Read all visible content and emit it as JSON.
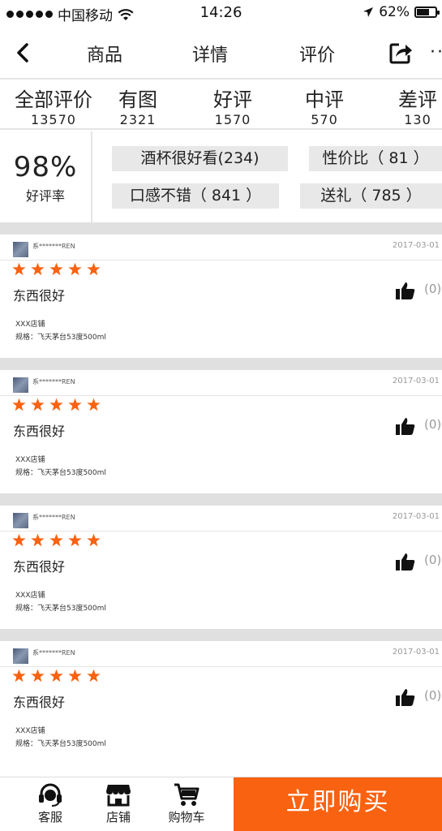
{
  "status_bar": {
    "carrier": "中国移动",
    "time": "14:26",
    "battery": "62%"
  },
  "nav": {
    "tabs": [
      "商品",
      "详情",
      "评价"
    ]
  },
  "filters": [
    {
      "label": "全部评价",
      "count": "13570"
    },
    {
      "label": "有图",
      "count": "2321"
    },
    {
      "label": "好评",
      "count": "1570"
    },
    {
      "label": "中评",
      "count": "570"
    },
    {
      "label": "差评",
      "count": "130"
    }
  ],
  "summary": {
    "rate": "98%",
    "rate_label": "好评率",
    "tags": [
      "酒杯很好看(234)",
      "性价比（ 81 ）",
      "口感不错（ 841 ）",
      "送礼（ 785 ）"
    ]
  },
  "reviews": [
    {
      "user": "系*******REN",
      "date": "2017-03-01",
      "rating": 5,
      "text": "东西很好",
      "likes": "(0)",
      "shop": "XXX店铺",
      "spec": "规格：飞天茅台53度500ml"
    },
    {
      "user": "系*******REN",
      "date": "2017-03-01",
      "rating": 5,
      "text": "东西很好",
      "likes": "(0)",
      "shop": "XXX店铺",
      "spec": "规格：飞天茅台53度500ml"
    },
    {
      "user": "系*******REN",
      "date": "2017-03-01",
      "rating": 5,
      "text": "东西很好",
      "likes": "(0)",
      "shop": "XXX店铺",
      "spec": "规格：飞天茅台53度500ml"
    },
    {
      "user": "系*******REN",
      "date": "2017-03-01",
      "rating": 5,
      "text": "东西很好",
      "likes": "(0)",
      "shop": "XXX店铺",
      "spec": "规格：飞天茅台53度500ml"
    }
  ],
  "bottom_bar": {
    "service": "客服",
    "shop": "店铺",
    "cart": "购物车",
    "buy": "立即购买"
  },
  "colors": {
    "accent": "#f96210",
    "star": "#f96210",
    "separator": "#e0e0e0",
    "tag_bg": "#e8e8e8"
  },
  "icons": [
    "back-icon",
    "share-icon",
    "more-icon",
    "star-icon",
    "thumbs-up-icon",
    "headset-icon",
    "store-icon",
    "cart-icon"
  ]
}
